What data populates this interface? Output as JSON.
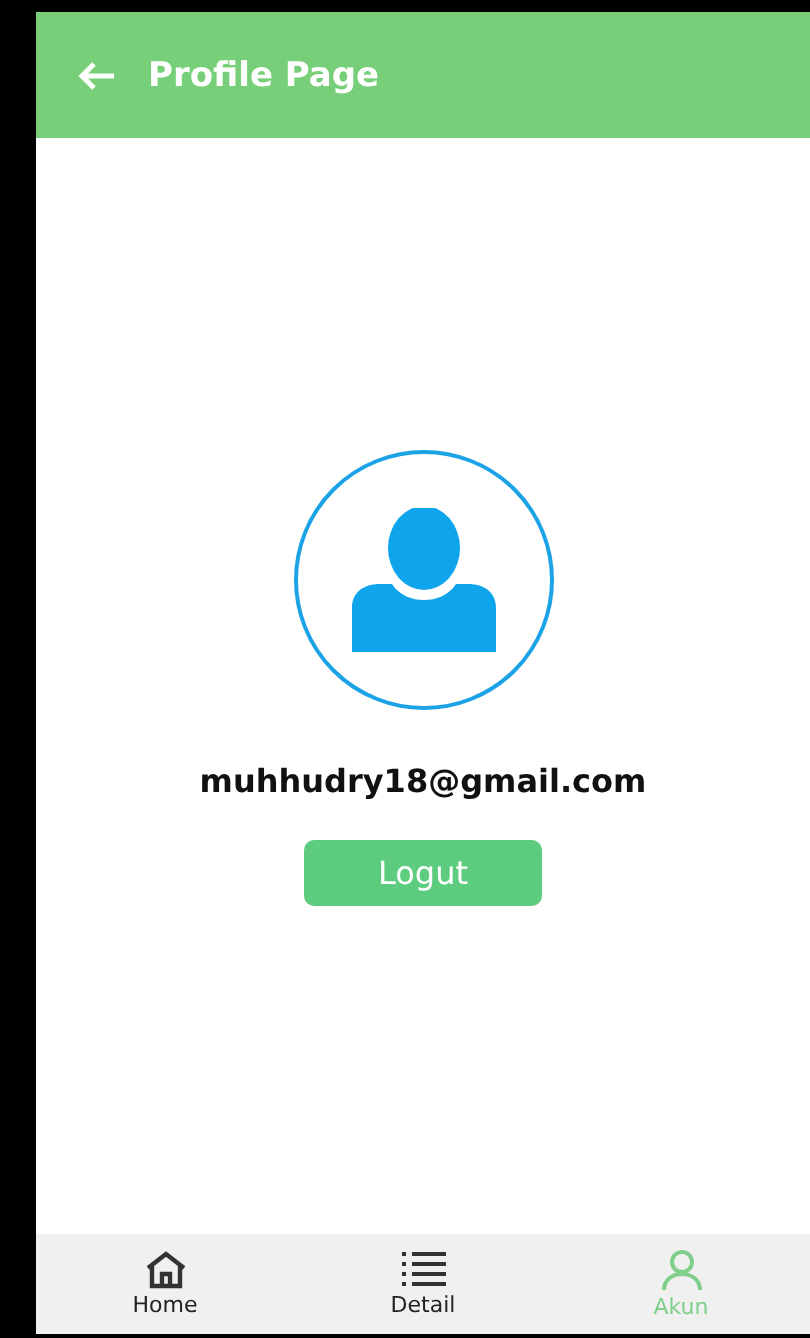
{
  "header": {
    "title": "Profile Page"
  },
  "profile": {
    "email": "muhhudry18@gmail.com",
    "button": "Logut"
  },
  "nav": [
    {
      "kind": "home",
      "label": "Home",
      "selected": false
    },
    {
      "kind": "list",
      "label": "Detail",
      "selected": false
    },
    {
      "kind": "user",
      "label": "Akun",
      "selected": true
    }
  ]
}
